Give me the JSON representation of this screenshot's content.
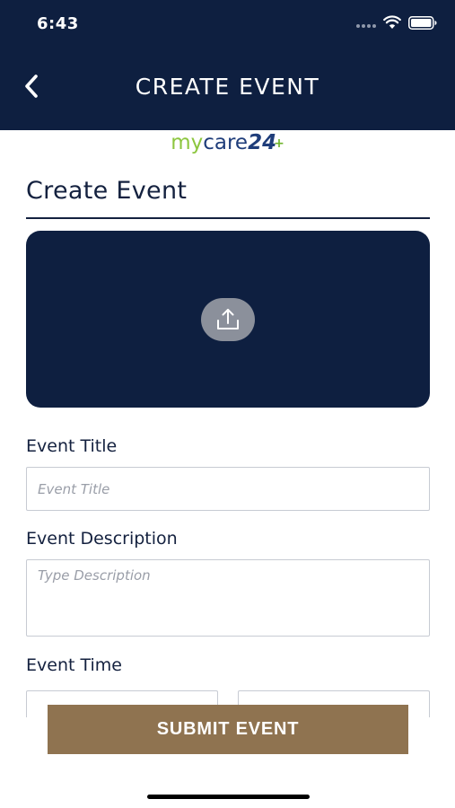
{
  "status_bar": {
    "time": "6:43",
    "icons": [
      "signal-icon",
      "wifi-icon",
      "battery-icon"
    ]
  },
  "header": {
    "back_icon": "chevron-left-icon",
    "title": "CREATE EVENT"
  },
  "logo": {
    "part1": "my",
    "part2": "care",
    "part3": "24",
    "part4": "+"
  },
  "form": {
    "section_title": "Create Event",
    "upload": {
      "icon": "upload-icon"
    },
    "event_title": {
      "label": "Event Title",
      "value": "",
      "placeholder": "Event Title"
    },
    "event_description": {
      "label": "Event Description",
      "value": "",
      "placeholder": "Type Description"
    },
    "event_time": {
      "label": "Event Time",
      "start_value": "",
      "end_value": ""
    }
  },
  "actions": {
    "submit_label": "SUBMIT EVENT"
  },
  "colors": {
    "navy": "#0e1f40",
    "accent_gold": "#8f7350",
    "logo_green": "#8dc63f",
    "logo_blue": "#1f3d7a"
  }
}
